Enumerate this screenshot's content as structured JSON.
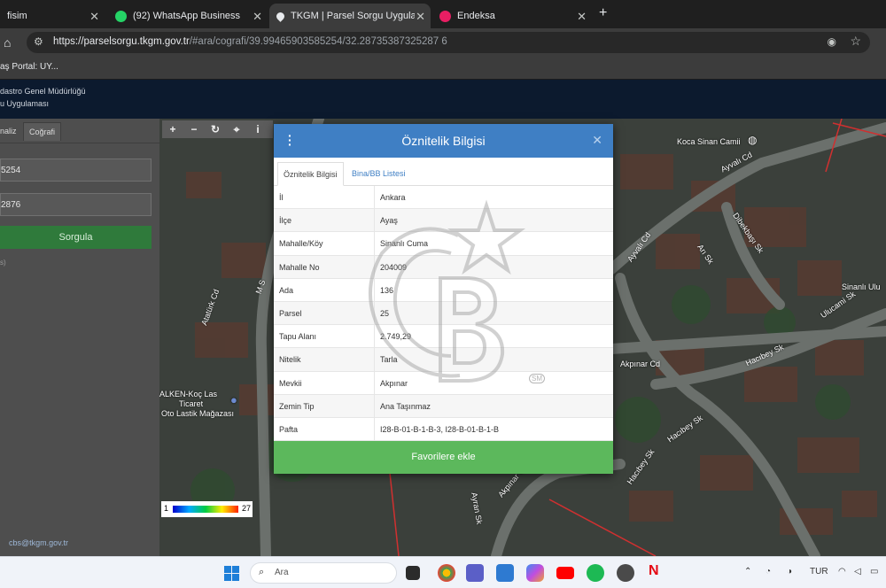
{
  "browser": {
    "tabs": [
      {
        "title": "fisim",
        "active": false
      },
      {
        "title": "(92) WhatsApp Business",
        "active": false
      },
      {
        "title": "TKGM | Parsel Sorgu Uygulamas",
        "active": true
      },
      {
        "title": "Endeksa",
        "active": false
      }
    ],
    "new_tab_glyph": "+",
    "url_host": "https://parselsorgu.tkgm.gov.tr",
    "url_path": "/#ara/cografi/39.99465903585254/32.28735387325287 6",
    "bookmark": "aş Portal: UY..."
  },
  "site": {
    "header_line1": "dastro Genel Müdürlüğü",
    "header_line2": "u Uygulaması"
  },
  "left_panel": {
    "tabs": [
      "naliz",
      "Coğrafi"
    ],
    "lat_value": "5254",
    "lon_value": "2876",
    "query_button": "Sorgula",
    "small_text": "s)",
    "email": "cbs@tkgm.gov.tr"
  },
  "map": {
    "tools": [
      "+",
      "−",
      "↻",
      "⌖",
      "i"
    ],
    "labels": {
      "mosque": "Koca Sinan Camii",
      "ayvali_cd_1": "Ayvalı Cd",
      "ayvali_cd_2": "Ayvalı Cd",
      "dibekbasi": "Dibekbaşı Sk",
      "ari_sk": "Arı Sk",
      "sinanli": "Sinanlı Ulu",
      "ulucami": "Ulucami Sk",
      "hacibey_sk_1": "Hacıbey Sk",
      "hacibey_sk_2": "Hacıbey Sk",
      "akpinar_cd_1": "Akpınar Cd",
      "akpinar_cd_2": "Akpınar Cd",
      "ataturk_cd": "Atatürk Cd",
      "m_s": "M S",
      "alken_1": "ALKEN-Koç Las",
      "alken_2": "Ticaret",
      "alken_3": "Oto Lastik Mağazası",
      "hacibey_sk_3": "Hacıbey Sk",
      "ayran_sk": "Ayran Sk"
    },
    "legend_min": "1",
    "legend_max": "27"
  },
  "modal": {
    "title": "Öznitelik Bilgisi",
    "tabs": {
      "active": "Öznitelik Bilgisi",
      "other": "Bina/BB Listesi"
    },
    "rows": [
      {
        "key": "İl",
        "value": "Ankara"
      },
      {
        "key": "İlçe",
        "value": "Ayaş"
      },
      {
        "key": "Mahalle/Köy",
        "value": "Sinanlı Cuma"
      },
      {
        "key": "Mahalle No",
        "value": "204009"
      },
      {
        "key": "Ada",
        "value": "136"
      },
      {
        "key": "Parsel",
        "value": "25"
      },
      {
        "key": "Tapu Alanı",
        "value": "2.749,29"
      },
      {
        "key": "Nitelik",
        "value": "Tarla"
      },
      {
        "key": "Mevkii",
        "value": "Akpınar"
      },
      {
        "key": "Zemin Tip",
        "value": "Ana Taşınmaz"
      },
      {
        "key": "Pafta",
        "value": "I28-B-01-B-1-B-3, I28-B-01-B-1-B"
      }
    ],
    "favorite_button": "Favorilere ekle",
    "watermark_mark": "SM"
  },
  "taskbar": {
    "search_label": "Ara",
    "language": "TUR"
  },
  "colors": {
    "modal_header": "#3f7fc4",
    "favorite_button": "#5cb85c",
    "query_button": "#2f7a3b",
    "parcel_border": "#d03030"
  }
}
